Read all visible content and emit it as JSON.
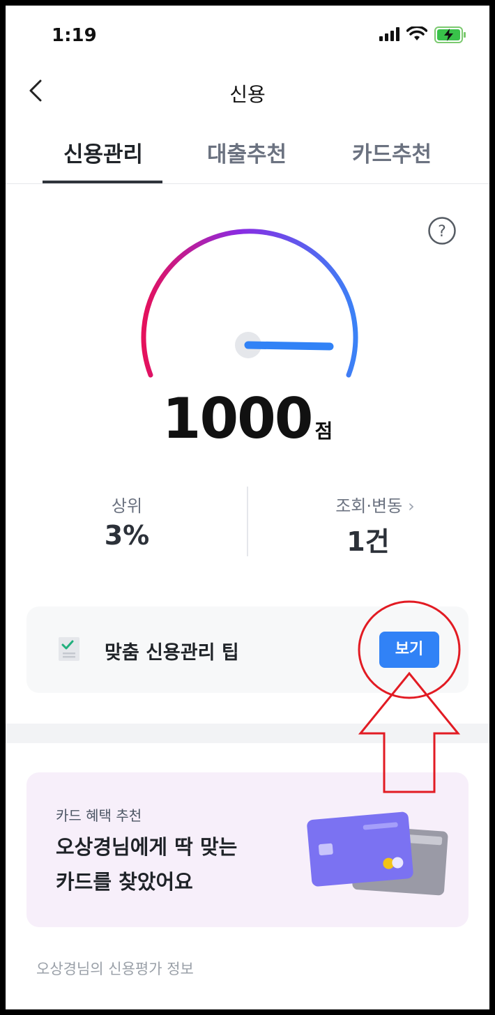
{
  "status_bar": {
    "time": "1:19"
  },
  "nav": {
    "title": "신용"
  },
  "tabs": [
    {
      "label": "신용관리",
      "active": true
    },
    {
      "label": "대출추천",
      "active": false
    },
    {
      "label": "카드추천",
      "active": false
    }
  ],
  "score": {
    "value": "1000",
    "unit": "점",
    "gauge_fraction": 1.0
  },
  "stats": {
    "rank": {
      "label": "상위",
      "value": "3%"
    },
    "inquiries": {
      "label": "조회·변동",
      "value": "1건"
    }
  },
  "tip": {
    "label": "맞춤 신용관리 팁",
    "button_label": "보기"
  },
  "promo": {
    "subtitle": "카드 혜택 추천",
    "title_line1": "오상경님에게 딱 맞는",
    "title_line2": "카드를 찾았어요"
  },
  "footer": {
    "label": "오상경님의 신용평가 정보"
  },
  "colors": {
    "accent": "#3182f6",
    "gauge_start": "#e5115b",
    "gauge_mid": "#8a2be2",
    "gauge_end": "#3b82f6",
    "annotation": "#e21b23"
  },
  "icons": [
    "back-chevron-icon",
    "help-icon",
    "checklist-icon",
    "chevron-right-icon",
    "card-illustration"
  ]
}
